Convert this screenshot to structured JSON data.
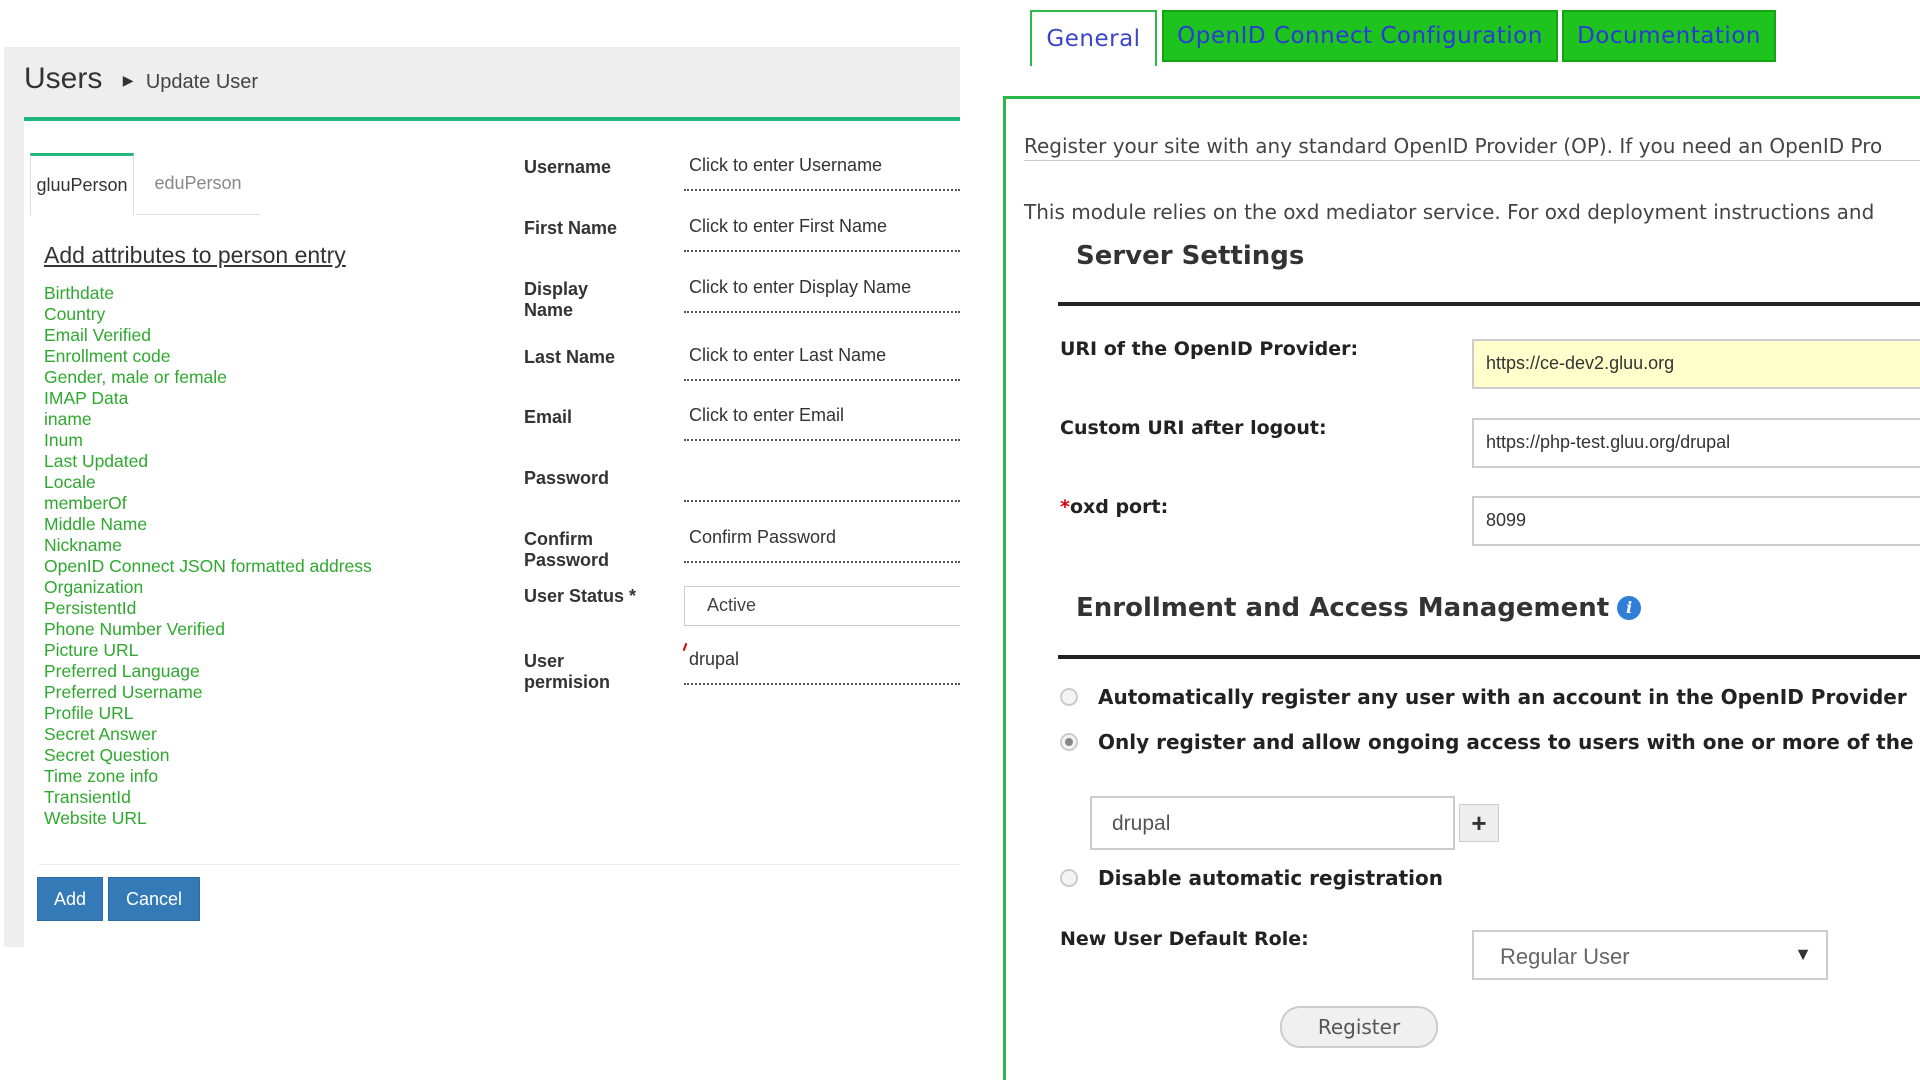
{
  "left": {
    "title": "Users",
    "breadcrumb": "Update User",
    "tabs": [
      {
        "label": "gluuPerson",
        "active": true
      },
      {
        "label": "eduPerson",
        "active": false
      }
    ],
    "attributes_heading": "Add attributes to person entry",
    "attributes": [
      "Birthdate",
      "Country",
      "Email Verified",
      "Enrollment code",
      "Gender, male or female",
      "IMAP Data",
      "iname",
      "Inum",
      "Last Updated",
      "Locale",
      "memberOf",
      "Middle Name",
      "Nickname",
      "OpenID Connect JSON formatted address",
      "Organization",
      "PersistentId",
      "Phone Number Verified",
      "Picture URL",
      "Preferred Language",
      "Preferred Username",
      "Profile URL",
      "Secret Answer",
      "Secret Question",
      "Time zone info",
      "TransientId",
      "Website URL"
    ],
    "form": {
      "username": {
        "label": "Username",
        "value": "Click to enter Username"
      },
      "first_name": {
        "label": "First Name",
        "value": "Click to enter First Name"
      },
      "display_name": {
        "label": "Display Name",
        "value": "Click to enter Display Name"
      },
      "last_name": {
        "label": "Last Name",
        "value": "Click to enter Last Name"
      },
      "email": {
        "label": "Email",
        "value": "Click to enter Email"
      },
      "password": {
        "label": "Password",
        "value": ""
      },
      "confirm_password": {
        "label": "Confirm Password",
        "value": "Confirm Password"
      },
      "user_status": {
        "label": "User Status *",
        "value": "Active"
      },
      "user_permission": {
        "label": "User permision",
        "value": "drupal"
      }
    },
    "buttons": {
      "add": "Add",
      "cancel": "Cancel"
    }
  },
  "right": {
    "tabs": [
      {
        "label": "General",
        "active": true
      },
      {
        "label": "OpenID Connect Configuration",
        "active": false
      },
      {
        "label": "Documentation",
        "active": false
      }
    ],
    "intro_1": "Register your site with any standard OpenID Provider (OP). If you need an OpenID Pro",
    "intro_2": "This module relies on the oxd mediator service. For oxd deployment instructions and",
    "server_settings_heading": "Server Settings",
    "uri_label": "URI of the OpenID Provider:",
    "uri_value": "https://ce-dev2.gluu.org",
    "logout_label": "Custom URI after logout:",
    "logout_value": "https://php-test.gluu.org/drupal",
    "oxd_port_star": "*",
    "oxd_port_label": "oxd port:",
    "oxd_port_value": "8099",
    "enrollment_heading": "Enrollment and Access Management",
    "radio_auto": "Automatically register any user with an account in the OpenID Provider",
    "radio_only": "Only register and allow ongoing access to users with one or more of the followi",
    "role_value": "drupal",
    "plus_label": "+",
    "radio_disable": "Disable automatic registration",
    "default_role_label": "New User Default Role:",
    "default_role_value": "Regular User",
    "register_button": "Register",
    "colors": {
      "accent_green": "#1ec31e",
      "tab_text_blue": "#2a3bd8",
      "link_green": "#2fa82f",
      "button_blue": "#337ab7"
    }
  }
}
